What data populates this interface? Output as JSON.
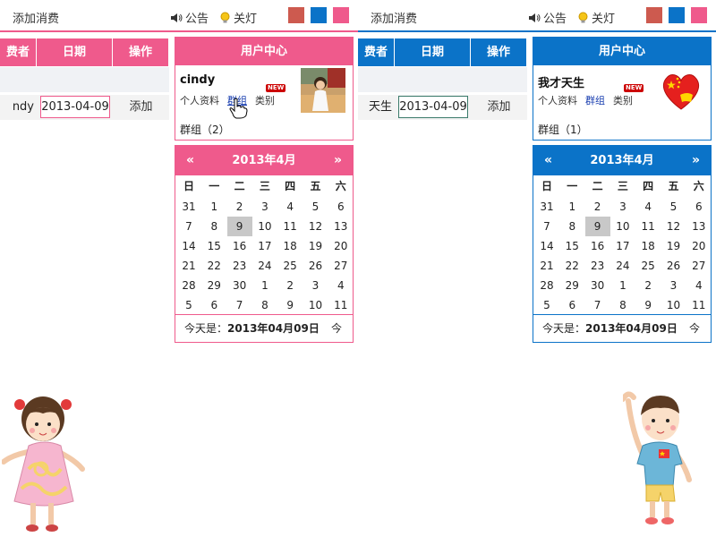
{
  "left": {
    "accent": "#ef5a8c",
    "swatches": [
      "#cd5a4f",
      "#0b73c8",
      "#ef5a8c"
    ],
    "header": {
      "title": "添加消费",
      "notice_label": "公告",
      "light_label": "关灯"
    },
    "table": {
      "headers": [
        "费者",
        "日期",
        "操作"
      ],
      "row": {
        "name": "ndy",
        "date": "2013-04-09",
        "action": "添加"
      }
    },
    "user_center": {
      "title": "用户中心",
      "username": "cindy",
      "links": [
        "个人资料",
        "群组",
        "类别"
      ],
      "new_badge": "NEW",
      "group_count": "群组（2）"
    },
    "calendar": {
      "prev": "«",
      "next": "»",
      "month_title": "2013年4月",
      "weekdays": [
        "日",
        "一",
        "二",
        "三",
        "四",
        "五",
        "六"
      ],
      "weeks": [
        [
          "31",
          "1",
          "2",
          "3",
          "4",
          "5",
          "6"
        ],
        [
          "7",
          "8",
          "9",
          "10",
          "11",
          "12",
          "13"
        ],
        [
          "14",
          "15",
          "16",
          "17",
          "18",
          "19",
          "20"
        ],
        [
          "21",
          "22",
          "23",
          "24",
          "25",
          "26",
          "27"
        ],
        [
          "28",
          "29",
          "30",
          "1",
          "2",
          "3",
          "4"
        ],
        [
          "5",
          "6",
          "7",
          "8",
          "9",
          "10",
          "11"
        ]
      ],
      "today_label": "今天是：",
      "today_date": "2013年04月09日",
      "jump_label": "今"
    }
  },
  "right": {
    "accent": "#0b73c8",
    "swatches": [
      "#cd5a4f",
      "#0b73c8",
      "#ef5a8c"
    ],
    "header": {
      "title": "添加消费",
      "notice_label": "公告",
      "light_label": "关灯"
    },
    "table": {
      "headers": [
        "费者",
        "日期",
        "操作"
      ],
      "row": {
        "name": "天生",
        "date": "2013-04-09",
        "action": "添加"
      }
    },
    "user_center": {
      "title": "用户中心",
      "username": "我才天生",
      "links": [
        "个人资料",
        "群组",
        "类别"
      ],
      "new_badge": "NEW",
      "group_count": "群组（1）"
    },
    "calendar": {
      "prev": "«",
      "next": "»",
      "month_title": "2013年4月",
      "weekdays": [
        "日",
        "一",
        "二",
        "三",
        "四",
        "五",
        "六"
      ],
      "weeks": [
        [
          "31",
          "1",
          "2",
          "3",
          "4",
          "5",
          "6"
        ],
        [
          "7",
          "8",
          "9",
          "10",
          "11",
          "12",
          "13"
        ],
        [
          "14",
          "15",
          "16",
          "17",
          "18",
          "19",
          "20"
        ],
        [
          "21",
          "22",
          "23",
          "24",
          "25",
          "26",
          "27"
        ],
        [
          "28",
          "29",
          "30",
          "1",
          "2",
          "3",
          "4"
        ],
        [
          "5",
          "6",
          "7",
          "8",
          "9",
          "10",
          "11"
        ]
      ],
      "today_label": "今天是：",
      "today_date": "2013年04月09日",
      "jump_label": "今"
    }
  }
}
